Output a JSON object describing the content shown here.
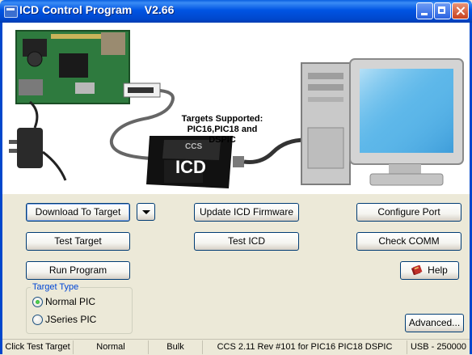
{
  "window": {
    "title": "ICD Control Program    V2.66"
  },
  "illustration": {
    "targets_label_line1": "Targets Supported:",
    "targets_label_line2": "PIC16,PIC18 and",
    "targets_label_line3": "DSPIC",
    "icd_label": "ICD",
    "ccs_label": "CCS"
  },
  "buttons": {
    "download": "Download To Target",
    "update_firmware": "Update ICD Firmware",
    "configure_port": "Configure Port",
    "test_target": "Test Target",
    "test_icd": "Test ICD",
    "check_comm": "Check COMM",
    "run_program": "Run Program",
    "help": "Help",
    "advanced": "Advanced..."
  },
  "target_type": {
    "legend": "Target Type",
    "options": [
      "Normal PIC",
      "JSeries PIC"
    ],
    "selected": "Normal PIC"
  },
  "statusbar": {
    "message": "Click Test Target",
    "mode": "Normal",
    "transfer": "Bulk",
    "version": "CCS 2.11 Rev #101 for PIC16 PIC18 DSPIC",
    "connection": "USB - 250000"
  },
  "colors": {
    "titlebar": "#0054E3",
    "dialog_bg": "#ECE9D8",
    "groupbox_legend": "#0046D5"
  }
}
